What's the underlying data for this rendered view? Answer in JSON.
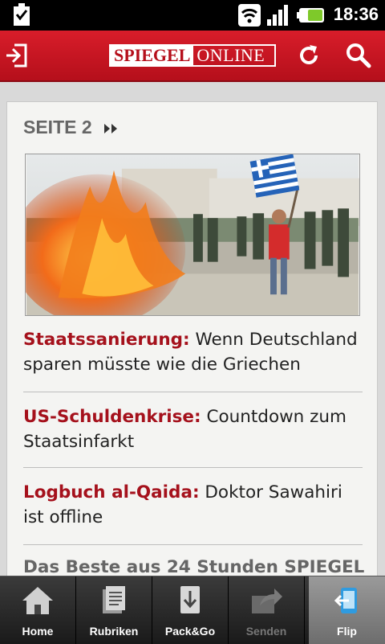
{
  "status": {
    "time": "18:36"
  },
  "header": {
    "logo_part1": "SPIEGEL",
    "logo_part2": "ONLINE"
  },
  "section": {
    "title": "SEITE 2"
  },
  "articles": [
    {
      "kicker": "Staatssanierung:",
      "headline": " Wenn Deutschland sparen müsste wie die Griechen"
    },
    {
      "kicker": "US-Schuldenkrise:",
      "headline": " Countdown zum Staatsinfarkt"
    },
    {
      "kicker": "Logbuch al-Qaida:",
      "headline": " Doktor Sawahiri ist offline"
    }
  ],
  "teaser": "Das Beste aus 24 Stunden SPIEGEL",
  "tabs": [
    {
      "label": "Home",
      "icon": "home-icon"
    },
    {
      "label": "Rubriken",
      "icon": "document-icon"
    },
    {
      "label": "Pack&Go",
      "icon": "download-icon"
    },
    {
      "label": "Senden",
      "icon": "share-icon"
    },
    {
      "label": "Flip",
      "icon": "flip-icon"
    }
  ],
  "colors": {
    "brand_red": "#c8141f",
    "kicker_red": "#a5111c"
  }
}
